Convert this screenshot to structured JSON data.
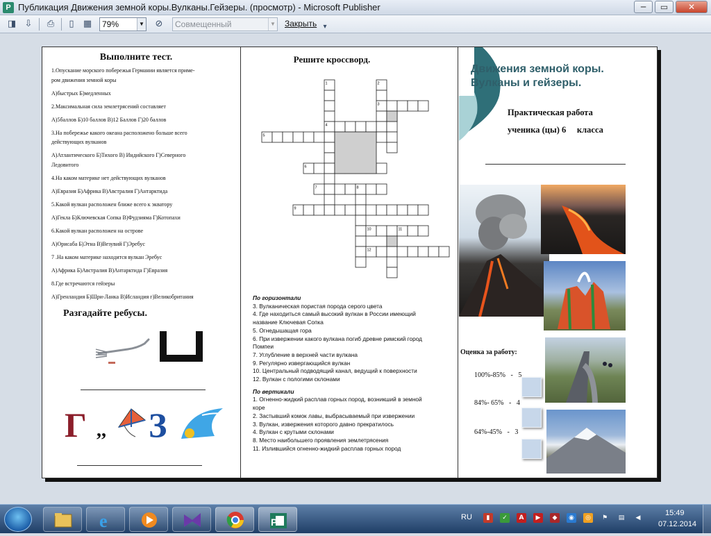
{
  "window": {
    "title": "Публикация Движения земной коры.Вулканы.Гейзеры. (просмотр)  - Microsoft Publisher",
    "app_icon_letter": "P",
    "minimize_glyph": "─",
    "maximize_glyph": "▭",
    "close_glyph": "✕"
  },
  "toolbar": {
    "zoom_value": "79%",
    "view_mode": "Совмещенный",
    "close_preview_label": "Закрыть",
    "overflow_glyph": "▾",
    "icons": [
      "page-setup-icon",
      "save-icon",
      "print-icon",
      "single-page-icon",
      "multi-page-icon",
      "toggle-icon"
    ]
  },
  "panel_left": {
    "test_heading": "Выполните тест.",
    "test_lines": [
      "1.Опускание морского побережья Германии является приме-",
      "ром движения земной коры",
      "А)быстрых Б)медленных",
      "2.Максимальная сила землетрясений составляет",
      "А)5баллов Б)10 баллов В)12 Баллов Г)20 баллов",
      "3.На побережье какого океана расположено больше всего",
      "действующих вулканов",
      "А)Атлантического Б)Тихого В) Индийского Г)Северного",
      "Ледовитого",
      "4.На каком материке нет действующих вулканов",
      "А)Евразия Б)Африка В)Австралия Г)Антарктида",
      "5.Какой вулкан расположен ближе всего к экватору",
      "А)Гекла Б)Ключевская Сопка В)Фудзияма Г)Котопахи",
      "6.Какой вулкан расположен на острове",
      "А)Орисаба Б)Этна В)Везувий Г)Эребус",
      "7 .На каком материке находится вулкан Эребус",
      "А)Африка  Б)Австралия  В)Антарктида  Г)Евразия",
      "8.Где встречаются гейзеры",
      "А)Гренландия  Б)Шри-Ланка В)Исландия  г)Великобритания"
    ],
    "rebus_heading": "Разгадайте ребусы.",
    "rebus_letters": [
      "Г",
      ",,",
      "З"
    ]
  },
  "panel_middle": {
    "crossword_heading": "Решите кроссворд.",
    "clue_numbers": [
      "1",
      "2",
      "3",
      "4",
      "5",
      "6",
      "7",
      "8",
      "9",
      "10",
      "11",
      "12"
    ],
    "horizontal_heading": "По горизонтали",
    "horizontal_clues": [
      "3. Вулканическая пористая порода серого цвета",
      "4. Где находиться самый высокий вулкан в России имеющий",
      "название Ключевая Сопка",
      "5. Огнедышащая гора",
      "6. При извержении какого вулкана погиб древне римский город",
      "Помпеи",
      "7. Углубление в верхней части вулкана",
      "9. Регулярно извергающийся вулкан",
      "10. Центральный подводящий канал, ведущий к поверхности",
      "12. Вулкан с пологими склонами"
    ],
    "vertical_heading": "По вертикали",
    "vertical_clues": [
      "1. Огненно-жидкий расплав горных пород, возникший в земной",
      "коре",
      "2. Застывший комок лавы, выбрасываемый при извержении",
      "3. Вулкан, извержения которого давно прекратилось",
      "4. Вулкан с крутыми склонами",
      "8. Место наибольшего проявления землетрясения",
      "11. Излившийся огненно-жидкий расплав горных пород"
    ]
  },
  "panel_right": {
    "title_line1": "Движения земной коры.",
    "title_line2": "Вулканы и гейзеры.",
    "practical_label": "Практическая работа",
    "student_label": "ученика (цы) 6     класса",
    "grade_heading": "Оценка за работу:",
    "grades": [
      {
        "range": "100%-85%",
        "sep": "-",
        "mark": "5"
      },
      {
        "range": "84%- 65%",
        "sep": "-",
        "mark": "4"
      },
      {
        "range": "64%-45%",
        "sep": "-",
        "mark": "3"
      }
    ]
  },
  "taskbar": {
    "language": "RU",
    "time": "15:49",
    "date": "07.12.2014",
    "apps": [
      "explorer-icon",
      "ie-icon",
      "media-player-icon",
      "visual-studio-icon",
      "chrome-icon",
      "publisher-icon"
    ]
  },
  "colors": {
    "title_teal": "#2f5f6a",
    "accent_teal": "#3f8b92",
    "grade_box": "#c7d7ea",
    "crossword_shade": "#cfcfcf"
  }
}
